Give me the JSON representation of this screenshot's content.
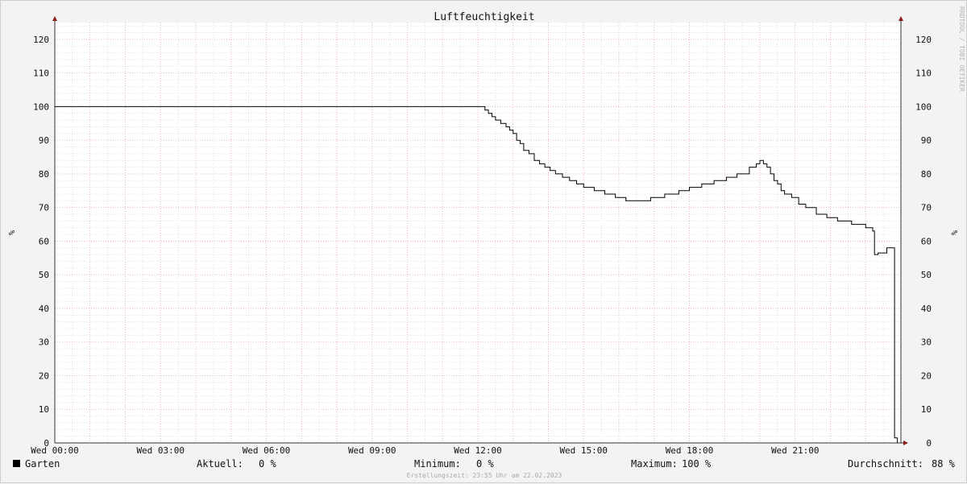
{
  "chart_data": {
    "type": "line",
    "title": "Luftfeuchtigkeit",
    "ylabel": "%",
    "ylim": [
      0,
      125
    ],
    "yticks": [
      0,
      10,
      20,
      30,
      40,
      50,
      60,
      70,
      80,
      90,
      100,
      110,
      120
    ],
    "xlim": [
      0,
      24
    ],
    "xticks": [
      {
        "h": 0,
        "label": "Wed 00:00"
      },
      {
        "h": 3,
        "label": "Wed 03:00"
      },
      {
        "h": 6,
        "label": "Wed 06:00"
      },
      {
        "h": 9,
        "label": "Wed 09:00"
      },
      {
        "h": 12,
        "label": "Wed 12:00"
      },
      {
        "h": 15,
        "label": "Wed 15:00"
      },
      {
        "h": 18,
        "label": "Wed 18:00"
      },
      {
        "h": 21,
        "label": "Wed 21:00"
      }
    ],
    "grid": true,
    "series": [
      {
        "name": "Garten",
        "color": "#000000",
        "x": [
          0,
          12.1,
          12.2,
          12.3,
          12.4,
          12.5,
          12.65,
          12.8,
          12.9,
          13.0,
          13.1,
          13.2,
          13.3,
          13.45,
          13.6,
          13.75,
          13.9,
          14.05,
          14.2,
          14.4,
          14.6,
          14.8,
          15.0,
          15.3,
          15.6,
          15.9,
          16.2,
          16.5,
          16.9,
          17.3,
          17.7,
          18.0,
          18.35,
          18.7,
          19.05,
          19.35,
          19.7,
          19.9,
          20.0,
          20.1,
          20.2,
          20.3,
          20.4,
          20.5,
          20.6,
          20.7,
          20.9,
          21.1,
          21.3,
          21.6,
          21.9,
          22.2,
          22.6,
          23.0,
          23.2,
          23.25,
          23.35,
          23.6,
          23.75,
          23.82,
          23.9
        ],
        "y": [
          100,
          100,
          99,
          98,
          97,
          96,
          95,
          94,
          93,
          92,
          90,
          89,
          87,
          86,
          84,
          83,
          82,
          81,
          80,
          79,
          78,
          77,
          76,
          75,
          74,
          73,
          72,
          72,
          73,
          74,
          75,
          76,
          77,
          78,
          79,
          80,
          82,
          83,
          84,
          83,
          82,
          80,
          78,
          77,
          75,
          74,
          73,
          71,
          70,
          68,
          67,
          66,
          65,
          64,
          63,
          56,
          56.5,
          58,
          58,
          1.5,
          0
        ]
      }
    ],
    "legend": {
      "series_name": "Garten",
      "stats": [
        {
          "label": "Aktuell:",
          "value": "0 %"
        },
        {
          "label": "Minimum:",
          "value": "0 %"
        },
        {
          "label": "Maximum:",
          "value": "100 %"
        },
        {
          "label": "Durchschnitt:",
          "value": "88 %"
        }
      ]
    },
    "footer": "Erstellungszeit: 23:55 Uhr am 22.02.2023",
    "watermark": "RRDTOOL / TOBI OETIKER"
  },
  "colors": {
    "background": "#f3f3f3",
    "plot_bg": "#ffffff",
    "minor_grid": "#d8d8d8",
    "major_grid": "#e6a1aa",
    "axis": "#333333",
    "arrow": "#8b1a1a",
    "line": "#000000"
  }
}
